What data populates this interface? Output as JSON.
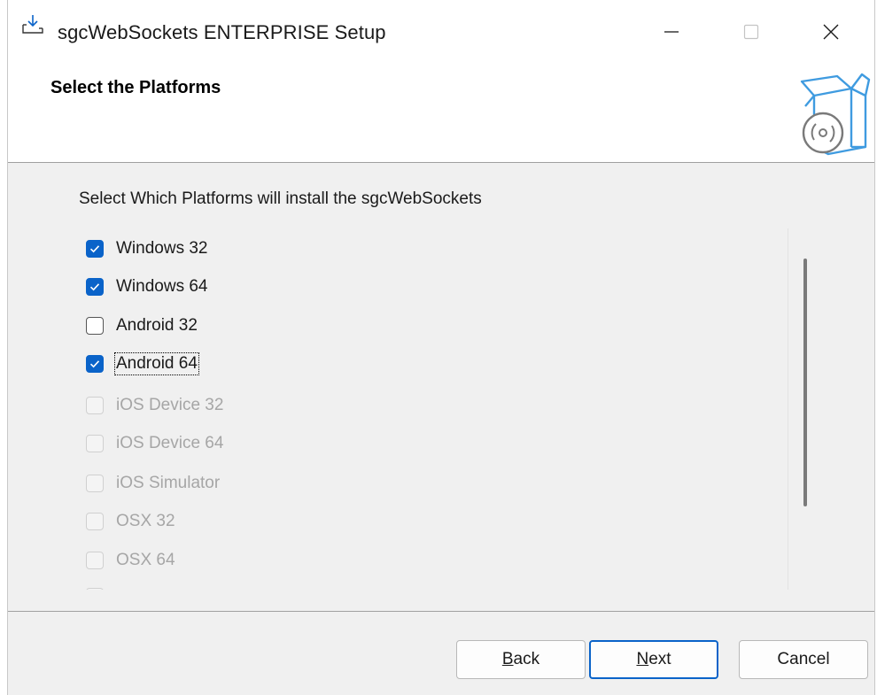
{
  "window": {
    "title": "sgcWebSockets ENTERPRISE Setup",
    "icon": "install-download-icon",
    "controls": [
      "minimize-icon",
      "maximize-icon",
      "close-icon"
    ]
  },
  "header": {
    "title": "Select the Platforms",
    "graphic": "software-box-disc-icon"
  },
  "main": {
    "instruction": "Select Which Platforms will install the sgcWebSockets",
    "platforms": [
      {
        "label": "Windows 32",
        "checked": true,
        "enabled": true
      },
      {
        "label": "Windows 64",
        "checked": true,
        "enabled": true
      },
      {
        "label": "Android 32",
        "checked": false,
        "enabled": true
      },
      {
        "label": "Android 64",
        "checked": true,
        "enabled": true,
        "focused": true
      },
      {
        "label": "iOS Device 32",
        "checked": false,
        "enabled": false
      },
      {
        "label": "iOS Device 64",
        "checked": false,
        "enabled": false
      },
      {
        "label": "iOS Simulator",
        "checked": false,
        "enabled": false
      },
      {
        "label": "OSX 32",
        "checked": false,
        "enabled": false
      },
      {
        "label": "OSX 64",
        "checked": false,
        "enabled": false
      },
      {
        "label": "",
        "checked": false,
        "enabled": false
      }
    ]
  },
  "footer": {
    "back_prefix": "",
    "back_mnemonic": "B",
    "back_rest": "ack",
    "next_prefix": "",
    "next_mnemonic": "N",
    "next_rest": "ext",
    "cancel_label": "Cancel"
  },
  "colors": {
    "accent": "#0a63c9",
    "disabled_text": "#a6a6a6",
    "dialog_bg": "#f0f0f0"
  }
}
